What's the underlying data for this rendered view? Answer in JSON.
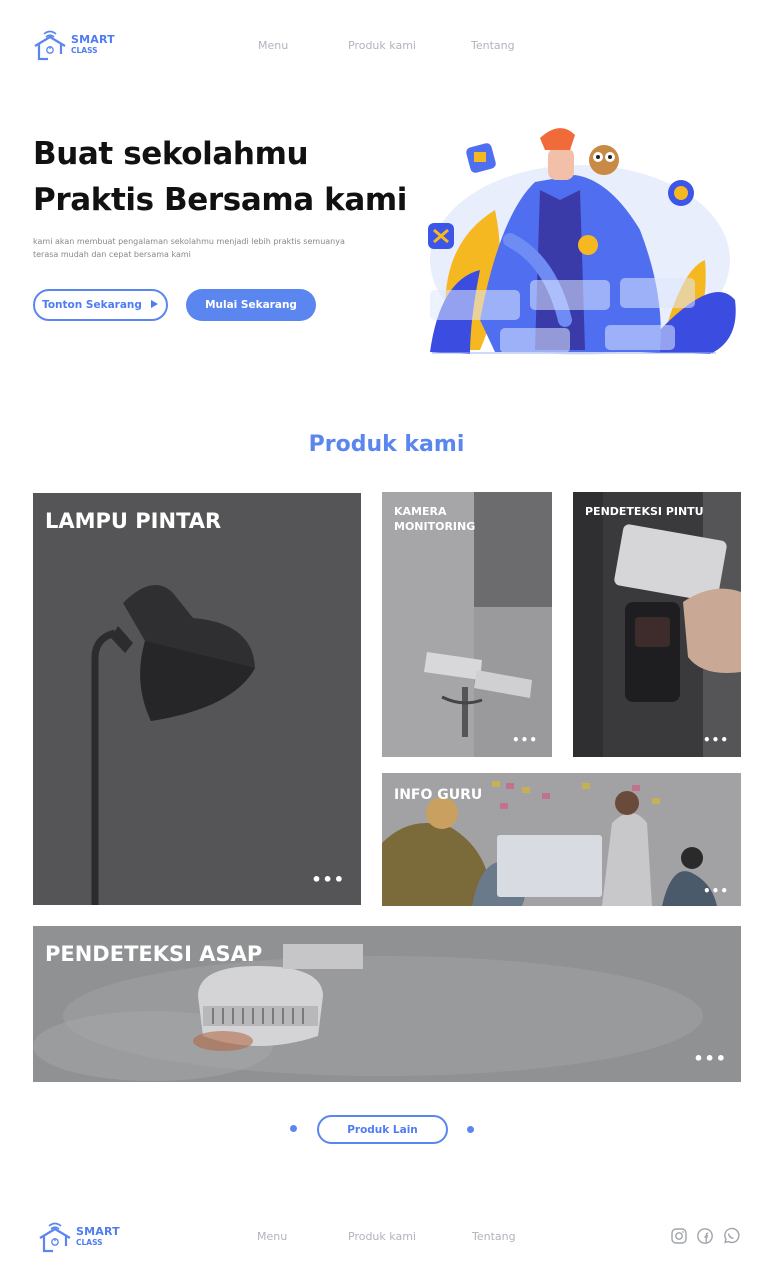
{
  "brand": {
    "name": "SMART",
    "sub": "CLASS"
  },
  "nav": {
    "menu": "Menu",
    "products": "Produk kami",
    "about": "Tentang"
  },
  "hero": {
    "title": "Buat sekolahmu Praktis Bersama kami",
    "subtitle": "kami akan membuat pengalaman sekolahmu menjadi lebih praktis semuanya terasa mudah dan cepat bersama kami",
    "watch_label": "Tonton Sekarang",
    "start_label": "Mulai Sekarang"
  },
  "products": {
    "title": "Produk kami",
    "items": [
      {
        "label": "LAMPU PINTAR",
        "more": "•••"
      },
      {
        "label": "KAMERA MONITORING",
        "more": "•••"
      },
      {
        "label": "PENDETEKSI PINTU",
        "more": "•••"
      },
      {
        "label": "INFO GURU",
        "more": "•••"
      },
      {
        "label": "PENDETEKSI ASAP",
        "more": "•••"
      }
    ],
    "more_label": "Produk Lain"
  },
  "icons": {
    "logo": "house-wifi-icon",
    "play": "play-icon",
    "social": [
      "instagram-icon",
      "facebook-icon",
      "whatsapp-icon"
    ]
  },
  "colors": {
    "accent": "#5b86f0",
    "muted": "#b0b4bc"
  }
}
